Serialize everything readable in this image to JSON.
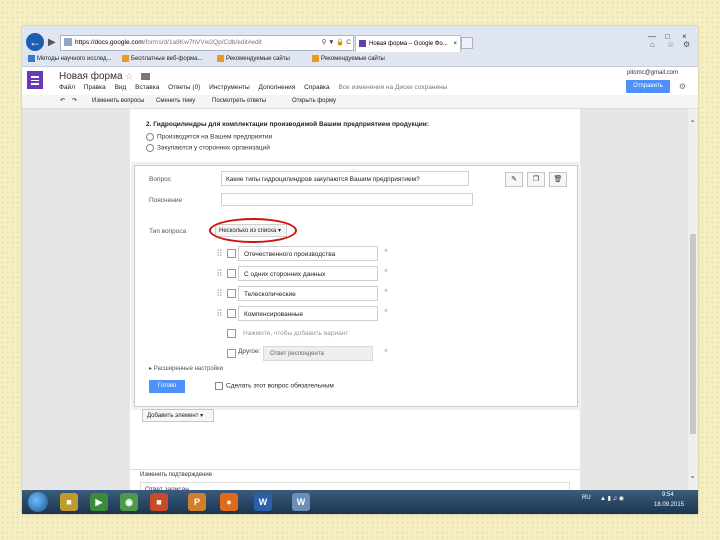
{
  "browser": {
    "url_host": "https://docs.google.com",
    "url_rest": "/forms/d/1a8Kw7hVVw2Qp/Cdb/edit#edit",
    "tab_title": "Новая форма – Google Фо...",
    "favorites": [
      "Методы научного исслед...",
      "Бесплатные веб-форма...",
      "Рекомендуемые сайты",
      "Рекомендуемые сайты"
    ]
  },
  "app": {
    "title": "Новая форма",
    "menu": [
      "Файл",
      "Правка",
      "Вид",
      "Вставка",
      "Ответы (0)",
      "Инструменты",
      "Дополнения",
      "Справка"
    ],
    "saved_status": "Все изменения на Диске сохранены",
    "email": "pitomc@gmail.com",
    "send_label": "Отправить"
  },
  "toolbar": [
    "Изменить вопросы",
    "Сменить тему",
    "Посмотреть ответы",
    "Открыть форму"
  ],
  "question2": {
    "title": "2. Гидроцилиндры для комплектации производимой Вашим предприятием продукции:",
    "options": [
      "Производятся на Вашем предприятии",
      "Закупаются у сторонних организаций"
    ]
  },
  "editor": {
    "question_label": "Вопрос",
    "question_value": "Какие типы гидроцилиндров закупаются Вашим предприятием?",
    "hint_label": "Пояснение",
    "type_label": "Тип вопроса",
    "type_value": "Несколько из списка",
    "options": [
      "Отечественного производства",
      "С одних сторонних данных",
      "Телескопические",
      "Компенсированные"
    ],
    "add_option_placeholder": "Нажмите, чтобы добавить вариант",
    "other_label": "Другое:",
    "other_placeholder": "Ответ респондента",
    "advanced": "Расширенные настройки",
    "done_label": "Готово",
    "required_label": "Сделать этот вопрос обязательным"
  },
  "add_item_label": "Добавить элемент",
  "confirmation": {
    "title": "Изменить подтверждение",
    "text": "Ответ записан."
  },
  "tray": {
    "lang": "RU",
    "time": "9:54",
    "date": "18.09.2015"
  }
}
